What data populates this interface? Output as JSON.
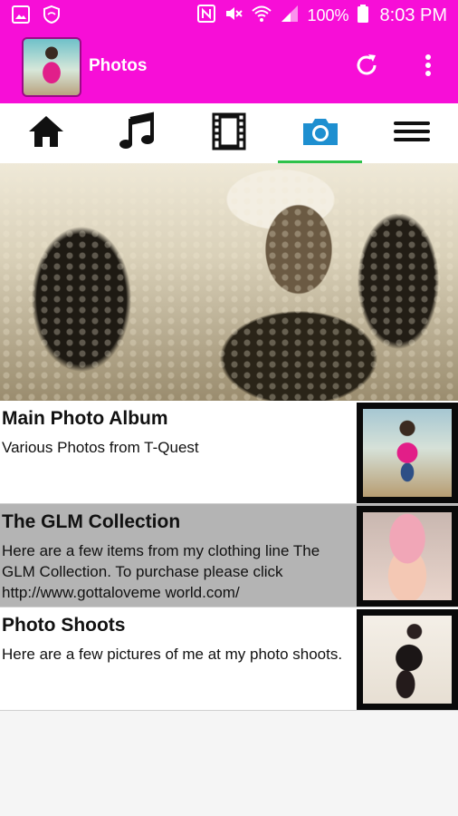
{
  "status_bar": {
    "battery": "100%",
    "time": "8:03 PM"
  },
  "app_bar": {
    "title": "Photos"
  },
  "tabs": [
    {
      "icon": "home-icon"
    },
    {
      "icon": "music-note-icon"
    },
    {
      "icon": "film-icon"
    },
    {
      "icon": "camera-icon",
      "active": true
    },
    {
      "icon": "menu-icon"
    }
  ],
  "colors": {
    "brand": "#f70ed7",
    "active_tab": "#1e8fd0",
    "tab_indicator": "#2ec24a",
    "highlight_row": "#b4b4b4"
  },
  "albums": [
    {
      "title": "Main Photo Album",
      "description": "Various Photos from T-Quest"
    },
    {
      "title": "The GLM Collection",
      "description": "Here are a few items from my clothing line The GLM Collection. To purchase please click http://www.gottaloveme world.com/"
    },
    {
      "title": "Photo Shoots",
      "description": "Here are a few pictures of me at my photo shoots."
    }
  ]
}
